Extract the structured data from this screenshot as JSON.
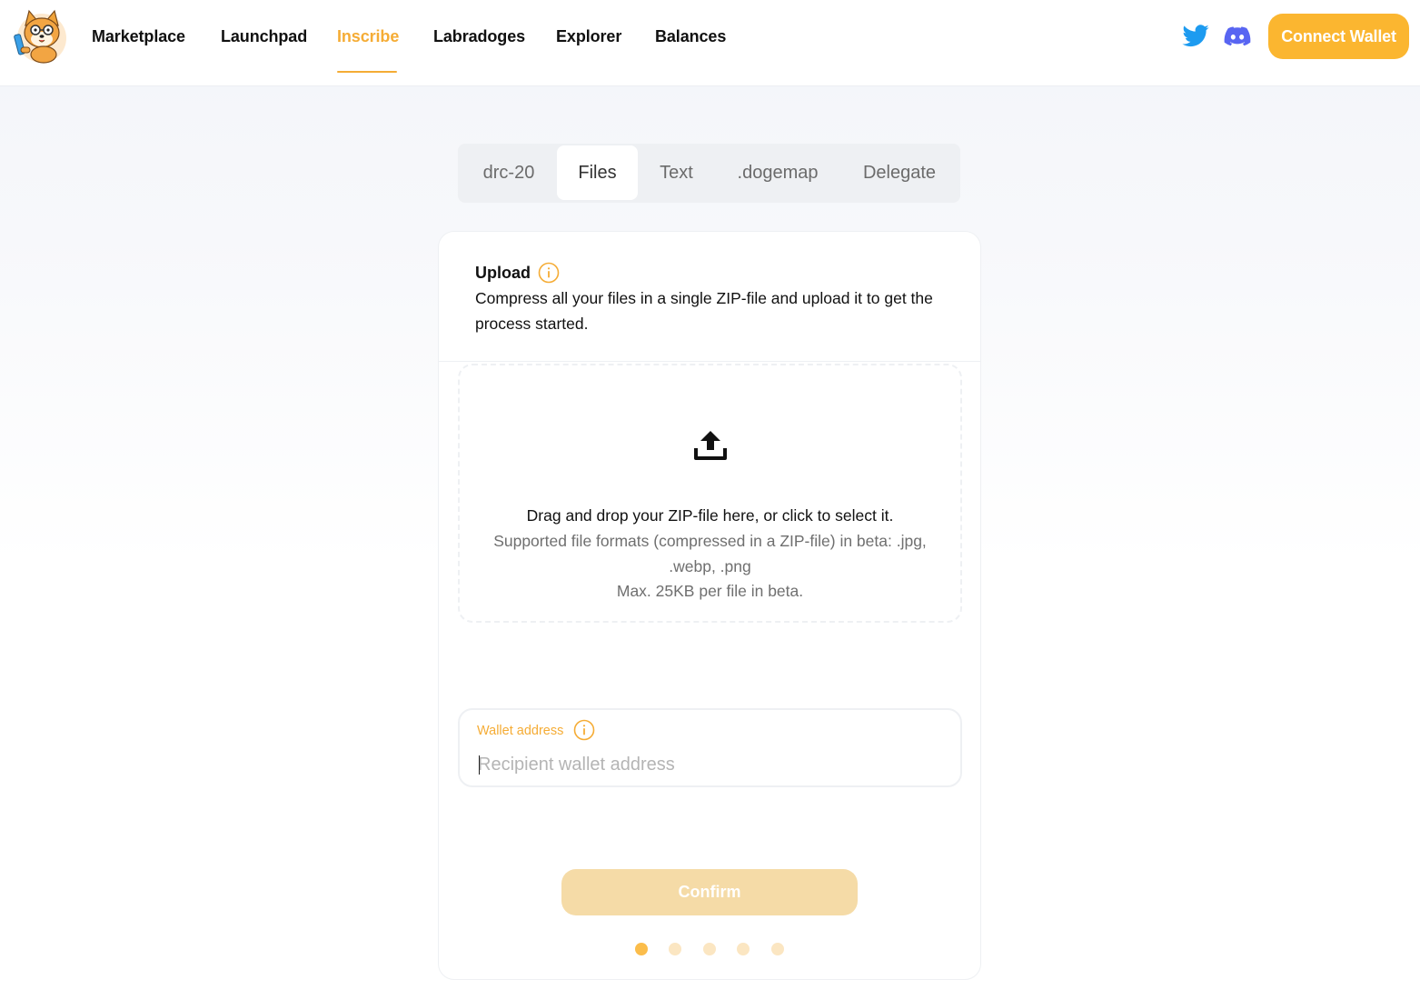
{
  "nav": {
    "items": [
      {
        "label": "Marketplace",
        "active": false
      },
      {
        "label": "Launchpad",
        "active": false
      },
      {
        "label": "Inscribe",
        "active": true
      },
      {
        "label": "Labradoges",
        "active": false
      },
      {
        "label": "Explorer",
        "active": false
      },
      {
        "label": "Balances",
        "active": false
      }
    ],
    "social_icons": [
      "twitter-icon",
      "discord-icon"
    ],
    "connect_label": "Connect Wallet"
  },
  "tabs": {
    "items": [
      {
        "label": "drc-20",
        "active": false
      },
      {
        "label": "Files",
        "active": true
      },
      {
        "label": "Text",
        "active": false
      },
      {
        "label": ".dogemap",
        "active": false
      },
      {
        "label": "Delegate",
        "active": false
      }
    ]
  },
  "upload": {
    "title": "Upload",
    "description": "Compress all your files in a single ZIP-file and upload it to get the process started.",
    "dropzone_main": "Drag and drop your ZIP-file here, or click to select it.",
    "dropzone_formats": "Supported file formats (compressed in a ZIP-file) in beta: .jpg, .webp, .png",
    "dropzone_max": "Max. 25KB per file in beta."
  },
  "wallet": {
    "label": "Wallet address",
    "placeholder": "Recipient wallet address",
    "value": ""
  },
  "confirm_label": "Confirm",
  "steps": {
    "total": 5,
    "current": 1
  },
  "colors": {
    "accent": "#f5ac35",
    "connect_button": "#fbb630",
    "confirm_disabled": "#f5dba7",
    "twitter": "#1d9bf0",
    "discord": "#5865f2"
  }
}
